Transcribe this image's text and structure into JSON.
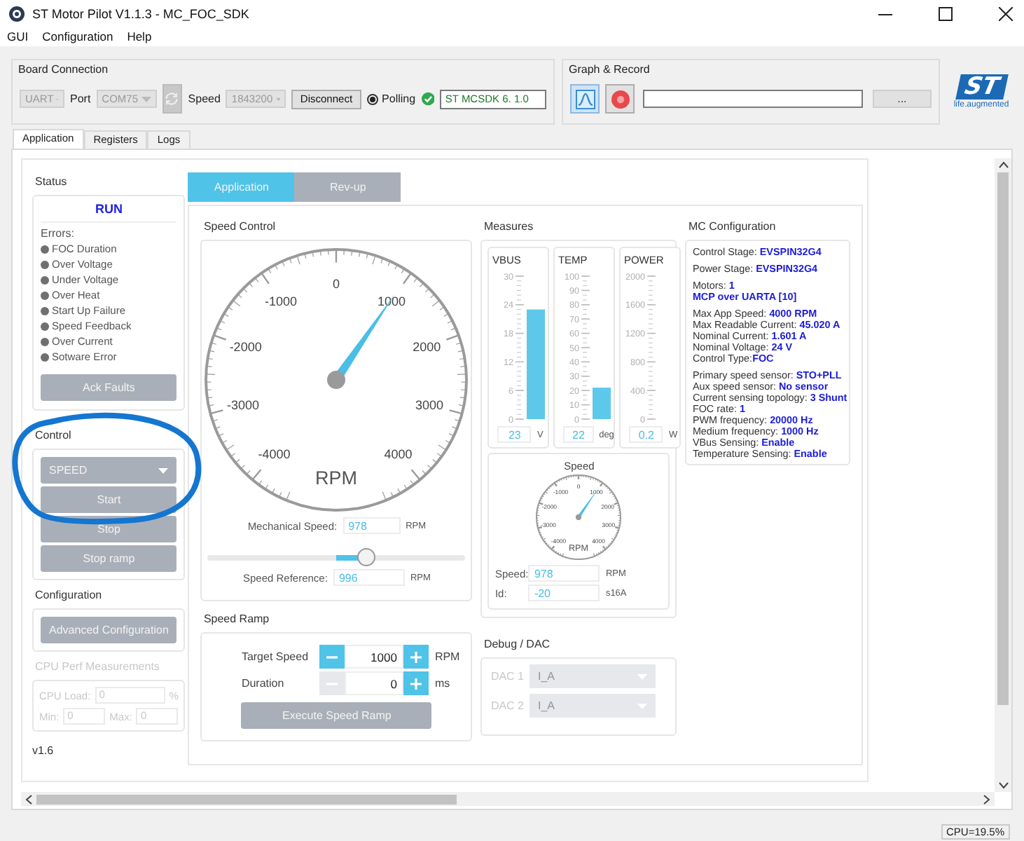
{
  "window": {
    "title": "ST Motor Pilot V1.1.3 - MC_FOC_SDK"
  },
  "menu": [
    "GUI",
    "Configuration",
    "Help"
  ],
  "board_connection": {
    "title": "Board Connection",
    "interface": "UART",
    "port_label": "Port",
    "port": "COM75",
    "speed_label": "Speed",
    "speed": "1843200",
    "disconnect": "Disconnect",
    "polling": {
      "label": "Polling",
      "selected": true
    },
    "connected": true,
    "firmware": "ST MCSDK 6. 1.0"
  },
  "graph_record": {
    "title": "Graph & Record",
    "browse": "..."
  },
  "logo": {
    "text": "ST",
    "tagline": "life.augmented"
  },
  "tabs": [
    {
      "label": "Application",
      "selected": true
    },
    {
      "label": "Registers",
      "selected": false
    },
    {
      "label": "Logs",
      "selected": false
    }
  ],
  "status": {
    "title": "Status",
    "state": "RUN",
    "errors_label": "Errors:",
    "errors": [
      {
        "label": "FOC Duration",
        "active": false
      },
      {
        "label": "Over Voltage",
        "active": false
      },
      {
        "label": "Under Voltage",
        "active": false
      },
      {
        "label": "Over Heat",
        "active": false
      },
      {
        "label": "Start Up Failure",
        "active": false
      },
      {
        "label": "Speed Feedback",
        "active": false
      },
      {
        "label": "Over Current",
        "active": false
      },
      {
        "label": "Sotware Error",
        "active": false
      }
    ],
    "ack": "Ack Faults"
  },
  "control": {
    "title": "Control",
    "mode": "SPEED",
    "buttons": [
      "Start",
      "Stop",
      "Stop ramp"
    ]
  },
  "configuration": {
    "title": "Configuration",
    "button": "Advanced Configuration"
  },
  "cpu_perf": {
    "title": "CPU Perf Measurements",
    "load_label": "CPU Load:",
    "load": "0",
    "load_unit": "%",
    "min_label": "Min:",
    "min": "0",
    "max_label": "Max:",
    "max": "0"
  },
  "version": "v1.6",
  "sub_tabs": [
    {
      "label": "Application",
      "selected": true
    },
    {
      "label": "Rev-up",
      "selected": false
    }
  ],
  "speed_control": {
    "title": "Speed Control",
    "gauge": {
      "ticks": [
        "-4000",
        "-3000",
        "-2000",
        "-1000",
        "0",
        "1000",
        "2000",
        "3000",
        "4000"
      ],
      "unit": "RPM",
      "level": 0.609
    },
    "mechanical_speed_label": "Mechanical Speed:",
    "mechanical_speed": "978",
    "mechanical_speed_unit": "RPM",
    "slider": {
      "level": 0.61
    },
    "reference_label": "Speed Reference:",
    "reference": "996",
    "reference_unit": "RPM"
  },
  "speed_ramp": {
    "title": "Speed Ramp",
    "spinners": [
      {
        "label": "Target Speed",
        "value": "1000",
        "unit": "RPM",
        "can_decrease": true
      },
      {
        "label": "Duration",
        "value": "0",
        "unit": "ms",
        "can_decrease": false
      }
    ],
    "execute": "Execute Speed Ramp"
  },
  "measures": {
    "title": "Measures",
    "bars": [
      {
        "name": "VBUS",
        "ticks": [
          "30",
          "24",
          "18",
          "12",
          "6",
          "0"
        ],
        "level": 0.767,
        "value": "23",
        "unit": "V"
      },
      {
        "name": "TEMP",
        "ticks": [
          "100",
          "90",
          "80",
          "70",
          "60",
          "50",
          "40",
          "30",
          "20",
          "10",
          "0"
        ],
        "level": 0.22,
        "value": "22",
        "unit": "deg"
      },
      {
        "name": "POWER",
        "ticks": [
          "2000",
          "1600",
          "1200",
          "800",
          "400",
          "0"
        ],
        "level": 0,
        "value": "0.2",
        "unit": "W"
      }
    ],
    "speed_gauge": {
      "title": "Speed",
      "ticks": [
        "-4000",
        "-3000",
        "-2000",
        "-1000",
        "0",
        "1000",
        "2000",
        "3000",
        "4000"
      ],
      "unit": "RPM",
      "level": 0.609
    },
    "speed_label": "Speed:",
    "speed": "978",
    "speed_unit": "RPM",
    "id_label": "Id:",
    "id": "-20",
    "id_unit": "s16A"
  },
  "debug_dac": {
    "title": "Debug / DAC",
    "dacs": [
      {
        "label": "DAC 1",
        "value": "I_A"
      },
      {
        "label": "DAC 2",
        "value": "I_A"
      }
    ]
  },
  "mc_configuration": {
    "title": "MC Configuration",
    "groups": [
      [
        "Control Stage: **EVSPIN32G4**"
      ],
      [
        "Power Stage: **EVSPIN32G4**"
      ],
      [
        "Motors: **1**",
        "**MCP over UARTA [10]**"
      ],
      [
        "Max App Speed: **4000 RPM**",
        "Max Readable Current: **45.020 A**",
        "Nominal Current: **1.601 A**",
        "Nominal Voltage: **24 V**",
        "Control Type:**FOC**"
      ],
      [
        "Primary speed sensor: **STO+PLL**",
        "Aux speed sensor: **No sensor**",
        "Current sensing topology: **3 Shunt**",
        "FOC rate: **1**",
        "PWM frequency: **20000 Hz**",
        "Medium frequency: **1000 Hz**",
        "VBus Sensing: **Enable**",
        "Temperature Sensing: **Enable**"
      ]
    ]
  },
  "status_bar": {
    "cpu": "CPU=19.5%"
  }
}
